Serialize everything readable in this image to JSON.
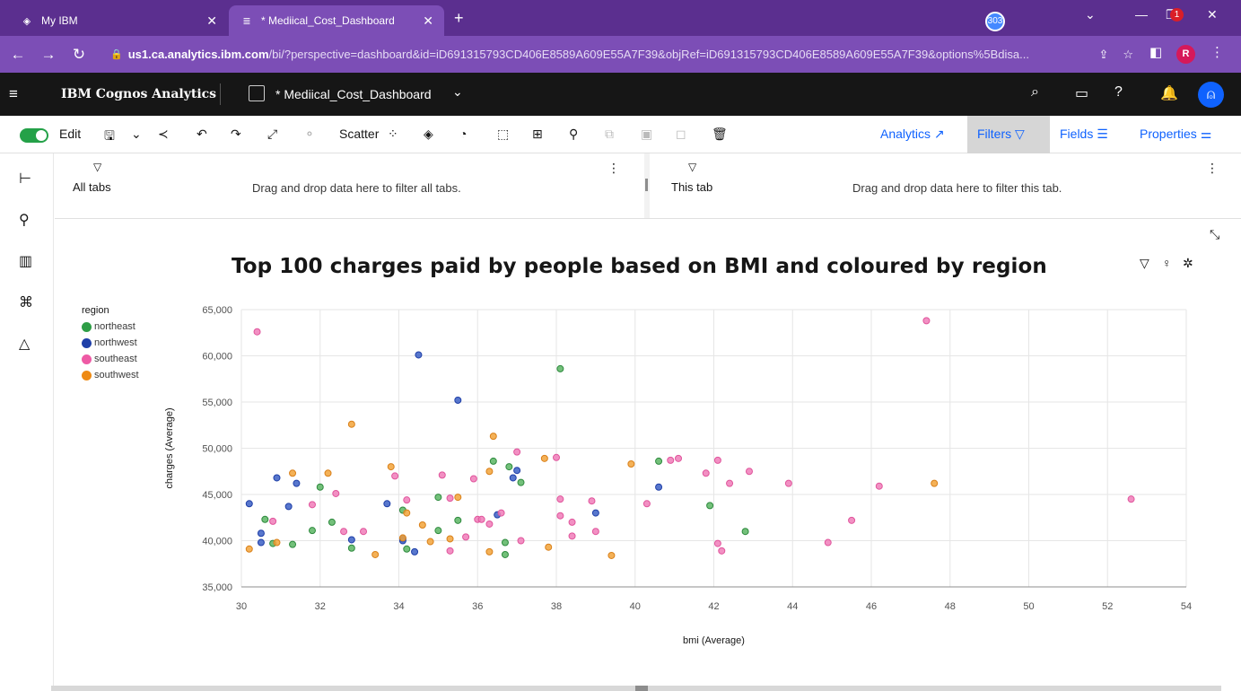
{
  "browser": {
    "tabs": [
      {
        "title": "My IBM",
        "active": false
      },
      {
        "title": "* Mediical_Cost_Dashboard",
        "active": true
      }
    ],
    "url_host": "us1.ca.analytics.ibm.com",
    "url_rest": "/bi/?perspective=dashboard&id=iD691315793CD406E8589A609E55A7F39&objRef=iD691315793CD406E8589A609E55A7F39&options%5Bdisa...",
    "profile_initial": "R"
  },
  "app": {
    "brand": "IBM Cognos Analytics",
    "dashboard_name": "* Mediical_Cost_Dashboard",
    "notification_count_badge": "303",
    "bell_badge": "1"
  },
  "toolbar": {
    "edit_label": "Edit",
    "scatter_label": "Scatter",
    "analytics_label": "Analytics",
    "filters_label": "Filters",
    "fields_label": "Fields",
    "properties_label": "Properties"
  },
  "filterbar": {
    "all_tabs_label": "All tabs",
    "all_tabs_hint": "Drag and drop data here to filter all tabs.",
    "this_tab_label": "This tab",
    "this_tab_hint": "Drag and drop data here to filter this tab."
  },
  "colors": {
    "northeast": "#5bb563",
    "northwest": "#3b5fc4",
    "southeast": "#f07cb8",
    "southwest": "#f2a33a"
  },
  "chart_data": {
    "type": "scatter",
    "title": "Top 100 charges paid by people based on BMI and coloured by region",
    "xlabel": "bmi (Average)",
    "ylabel": "charges (Average)",
    "xlim": [
      30,
      54
    ],
    "ylim": [
      35000,
      65000
    ],
    "x_ticks": [
      "30",
      "32",
      "34",
      "36",
      "38",
      "40",
      "42",
      "44",
      "46",
      "48",
      "50",
      "52",
      "54"
    ],
    "y_ticks": [
      "35,000",
      "40,000",
      "45,000",
      "50,000",
      "55,000",
      "60,000",
      "65,000"
    ],
    "grid": true,
    "legend_title": "region",
    "legend_position": "top-left",
    "series": [
      {
        "name": "northeast",
        "points": [
          [
            30.6,
            42300
          ],
          [
            30.8,
            39700
          ],
          [
            31.3,
            39600
          ],
          [
            31.8,
            41100
          ],
          [
            32,
            45800
          ],
          [
            32.3,
            42000
          ],
          [
            32.8,
            39200
          ],
          [
            34.1,
            43300
          ],
          [
            34.2,
            39100
          ],
          [
            35,
            44700
          ],
          [
            35,
            41100
          ],
          [
            35.5,
            42200
          ],
          [
            36.4,
            48600
          ],
          [
            36.7,
            39800
          ],
          [
            36.7,
            38500
          ],
          [
            36.8,
            48000
          ],
          [
            37.1,
            46300
          ],
          [
            38.1,
            58600
          ],
          [
            40.6,
            48600
          ],
          [
            41.9,
            43800
          ],
          [
            42.8,
            41000
          ]
        ]
      },
      {
        "name": "northwest",
        "points": [
          [
            30.2,
            44000
          ],
          [
            30.5,
            40800
          ],
          [
            30.5,
            39800
          ],
          [
            30.9,
            46800
          ],
          [
            31.2,
            43700
          ],
          [
            31.4,
            46200
          ],
          [
            32.8,
            40100
          ],
          [
            33.7,
            44000
          ],
          [
            34.1,
            40200
          ],
          [
            34.1,
            40000
          ],
          [
            34.4,
            38800
          ],
          [
            34.5,
            60100
          ],
          [
            35.5,
            55200
          ],
          [
            36.5,
            42800
          ],
          [
            36.9,
            46800
          ],
          [
            37,
            47600
          ],
          [
            39,
            43000
          ],
          [
            40.6,
            45800
          ]
        ]
      },
      {
        "name": "southeast",
        "points": [
          [
            30.4,
            62600
          ],
          [
            30.8,
            42100
          ],
          [
            31.8,
            43900
          ],
          [
            32.4,
            45100
          ],
          [
            32.6,
            41000
          ],
          [
            33.1,
            41000
          ],
          [
            33.9,
            47000
          ],
          [
            34.2,
            44400
          ],
          [
            35.1,
            47100
          ],
          [
            35.3,
            44600
          ],
          [
            35.3,
            38900
          ],
          [
            35.7,
            40400
          ],
          [
            35.9,
            46700
          ],
          [
            36,
            42300
          ],
          [
            36.1,
            42300
          ],
          [
            36.3,
            41800
          ],
          [
            36.6,
            43000
          ],
          [
            37,
            49600
          ],
          [
            37.1,
            40000
          ],
          [
            38,
            49000
          ],
          [
            38.1,
            44500
          ],
          [
            38.1,
            42700
          ],
          [
            38.4,
            42000
          ],
          [
            38.4,
            40500
          ],
          [
            38.9,
            44300
          ],
          [
            39,
            41000
          ],
          [
            40.3,
            44000
          ],
          [
            40.9,
            48700
          ],
          [
            41.1,
            48900
          ],
          [
            41.8,
            47300
          ],
          [
            42.1,
            48700
          ],
          [
            42.1,
            39700
          ],
          [
            42.2,
            38900
          ],
          [
            42.4,
            46200
          ],
          [
            42.9,
            47500
          ],
          [
            43.9,
            46200
          ],
          [
            44.9,
            39800
          ],
          [
            45.5,
            42200
          ],
          [
            46.2,
            45900
          ],
          [
            47.4,
            63800
          ],
          [
            52.6,
            44500
          ]
        ]
      },
      {
        "name": "southwest",
        "points": [
          [
            30.2,
            39100
          ],
          [
            30.9,
            39800
          ],
          [
            31.3,
            47300
          ],
          [
            32.2,
            47300
          ],
          [
            32.8,
            52600
          ],
          [
            33.4,
            38500
          ],
          [
            33.8,
            48000
          ],
          [
            34.1,
            40300
          ],
          [
            34.2,
            43000
          ],
          [
            34.6,
            41700
          ],
          [
            34.8,
            39900
          ],
          [
            35.3,
            40200
          ],
          [
            35.5,
            44700
          ],
          [
            36.3,
            47500
          ],
          [
            36.3,
            38800
          ],
          [
            36.4,
            51300
          ],
          [
            37.7,
            48900
          ],
          [
            37.8,
            39300
          ],
          [
            39.4,
            38400
          ],
          [
            39.9,
            48300
          ],
          [
            47.6,
            46200
          ]
        ]
      }
    ]
  }
}
